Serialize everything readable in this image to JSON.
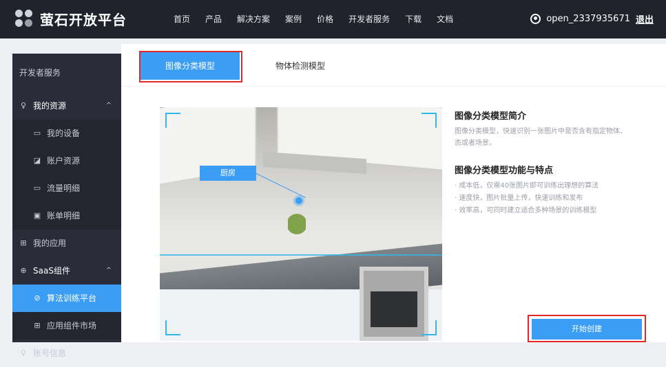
{
  "header": {
    "brand": "萤石开放平台",
    "nav": [
      "首页",
      "产品",
      "解决方案",
      "案例",
      "价格",
      "开发者服务",
      "下载",
      "文档"
    ],
    "username": "open_2337935671",
    "logout": "退出"
  },
  "sidebar": {
    "title": "开发者服务",
    "items": [
      {
        "label": "我的资源",
        "icon": "person-icon",
        "caret": "^"
      },
      {
        "label": "我的设备",
        "icon": "monitor-icon"
      },
      {
        "label": "账户资源",
        "icon": "chart-icon"
      },
      {
        "label": "流量明细",
        "icon": "monitor-icon"
      },
      {
        "label": "账单明细",
        "icon": "bill-icon"
      },
      {
        "label": "我的应用",
        "icon": "grid-icon"
      },
      {
        "label": "SaaS组件",
        "icon": "globe-icon",
        "caret": "^"
      },
      {
        "label": "算法训练平台",
        "icon": "check-circle-icon"
      },
      {
        "label": "应用组件市场",
        "icon": "grid-icon"
      },
      {
        "label": "账号信息",
        "icon": "person-icon"
      }
    ]
  },
  "tabs": {
    "active": "图像分类模型",
    "inactive": "物体检测模型"
  },
  "image": {
    "tag": "厨房"
  },
  "info": {
    "title1": "图像分类模型简介",
    "desc1": "图像分类模型，快速识别一张图片中是否含有指定物体、",
    "desc2": "态或者场景。",
    "title2": "图像分类模型功能与特点",
    "features": [
      "成本低，仅需40张图片即可训练出理想的算法",
      "速度快，图片批量上传，快速训练和发布",
      "效率高，可同时建立适合多种场景的训练模型"
    ],
    "button": "开始创建"
  },
  "colors": {
    "accent": "#3b9df4",
    "topbar": "#21232c",
    "sidebar": "#2a2d39",
    "highlight": "#e02828"
  }
}
